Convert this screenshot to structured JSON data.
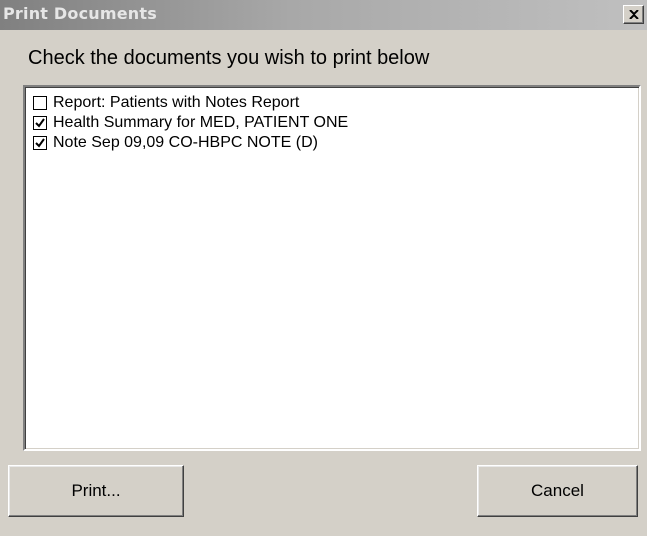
{
  "window": {
    "title": "Print Documents",
    "close_icon": "close-icon"
  },
  "instructions": "Check the documents you wish to print below",
  "documents": [
    {
      "label": "Report: Patients with Notes Report",
      "checked": false
    },
    {
      "label": "Health Summary for MED, PATIENT ONE",
      "checked": true
    },
    {
      "label": "Note Sep 09,09 CO-HBPC NOTE (D)",
      "checked": true
    }
  ],
  "buttons": {
    "print_label": "Print...",
    "cancel_label": "Cancel"
  },
  "colors": {
    "window_bg": "#d4d0c8",
    "list_bg": "#ffffff",
    "title_text": "#e6e6e6"
  }
}
